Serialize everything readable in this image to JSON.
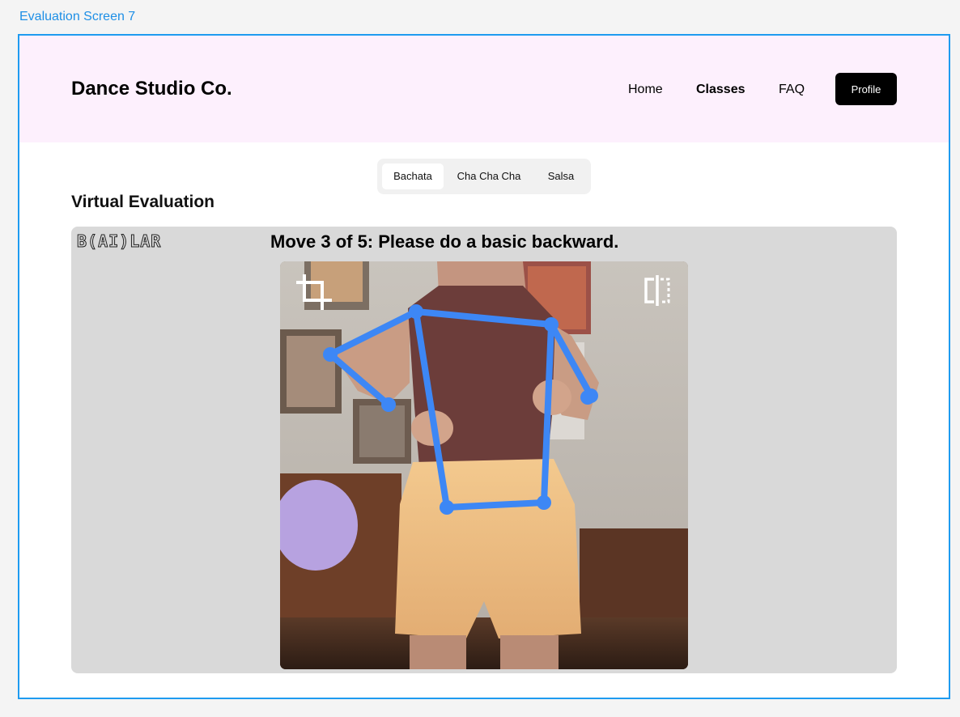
{
  "frame": {
    "label": "Evaluation Screen 7"
  },
  "header": {
    "brand": "Dance Studio Co.",
    "nav": [
      "Home",
      "Classes",
      "FAQ"
    ],
    "active_nav": "Classes",
    "profile_label": "Profile",
    "background": "#fdf0fd"
  },
  "tabs": {
    "items": [
      "Bachata",
      "Cha Cha Cha",
      "Salsa"
    ],
    "selected": "Bachata"
  },
  "section": {
    "title": "Virtual Evaluation"
  },
  "evaluation": {
    "logo_text": "B(AI)LAR",
    "instruction": "Move 3 of 5: Please do a basic backward.",
    "camera_icons": [
      "crop-icon",
      "mirror-icon"
    ],
    "skeleton_color": "#3d87f5"
  }
}
